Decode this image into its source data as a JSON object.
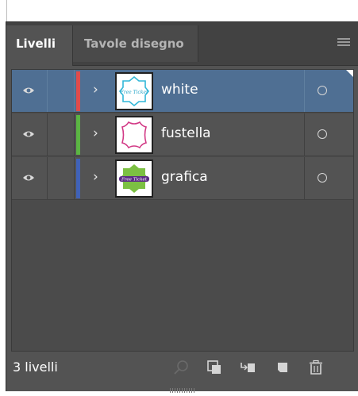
{
  "tabs": [
    {
      "label": "Livelli",
      "active": true
    },
    {
      "label": "Tavole disegno",
      "active": false
    }
  ],
  "menu_icon": "panel-menu-icon",
  "layers": [
    {
      "name": "white",
      "color": "#e04b4b",
      "selected": true,
      "visible": true,
      "thumb_text": "Free Ticket",
      "thumb": "label-outline-cyan"
    },
    {
      "name": "fustella",
      "color": "#5bb543",
      "selected": false,
      "visible": true,
      "thumb_text": "",
      "thumb": "label-outline-magenta"
    },
    {
      "name": "grafica",
      "color": "#4062b8",
      "selected": false,
      "visible": true,
      "thumb_text": "Free Ticket",
      "thumb": "label-filled-green"
    }
  ],
  "footer": {
    "count_label": "3 livelli",
    "icons": [
      "search-icon",
      "make-clipping-mask-icon",
      "create-sublayer-icon",
      "new-layer-icon",
      "trash-icon"
    ]
  },
  "colors": {
    "panel_bg": "#535353",
    "tab_bg": "#424242",
    "selected_row": "#4f6f93"
  }
}
